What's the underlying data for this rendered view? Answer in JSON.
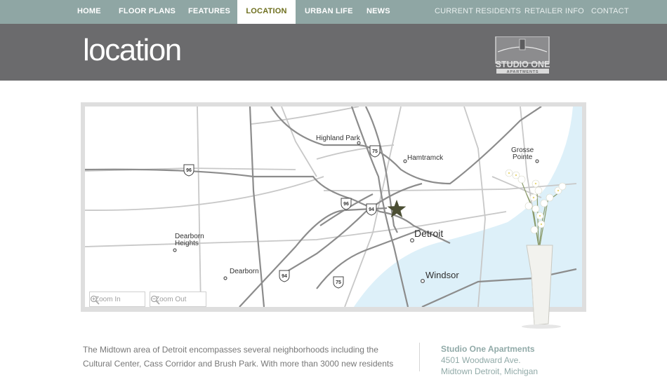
{
  "nav": {
    "main": [
      {
        "label": "HOME",
        "active": false
      },
      {
        "label": "FLOOR PLANS",
        "active": false
      },
      {
        "label": "FEATURES",
        "active": false
      },
      {
        "label": "LOCATION",
        "active": true
      },
      {
        "label": "URBAN LIFE",
        "active": false
      },
      {
        "label": "NEWS",
        "active": false
      }
    ],
    "utility": [
      "CURRENT RESIDENTS",
      "RETAILER INFO",
      "CONTACT"
    ]
  },
  "header": {
    "title": "location",
    "logo": {
      "line1": "STUDIO ONE",
      "line2": "APARTMENTS"
    }
  },
  "map": {
    "labels": {
      "highland_park": "Highland Park",
      "hamtramck": "Hamtramck",
      "grosse_pointe_1": "Grosse",
      "grosse_pointe_2": "Pointe",
      "dearborn_heights_1": "Dearborn",
      "dearborn_heights_2": "Heights",
      "dearborn": "Dearborn",
      "detroit": "Detroit",
      "windsor": "Windsor"
    },
    "shields": {
      "i96_west": "96",
      "i96_center": "96",
      "i94_center": "94",
      "i94_south": "94",
      "i75_north": "75",
      "i75_south": "75"
    },
    "zoom_in": "Zoom In",
    "zoom_out": "Zoom Out",
    "colors": {
      "water": "#ddf0f9",
      "highway": "#8a8a8a",
      "road": "#c4c4c4",
      "marker": "#4b4e33"
    }
  },
  "intro": "The Midtown area of Detroit encompasses several neighborhoods including the Cultural Center, Cass Corridor and Brush Park. With more than 3000 new residents",
  "contact": {
    "name": "Studio One Apartments",
    "address1": "4501 Woodward Ave.",
    "address2": "Midtown Detroit, Michigan"
  },
  "colors": {
    "nav_bg": "#8fa6a4",
    "header_bg": "#6b6b6d",
    "active_text": "#6e6f1e",
    "contact_text": "#91aaa8"
  }
}
